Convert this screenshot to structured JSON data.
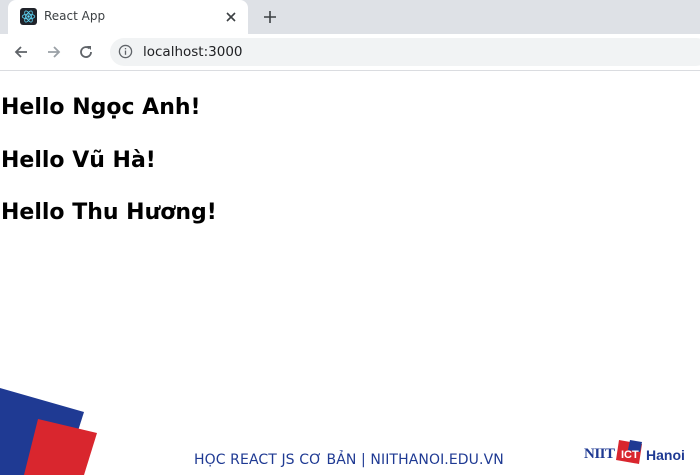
{
  "browser": {
    "tab": {
      "title": "React App"
    },
    "address_bar": {
      "url": "localhost:3000"
    }
  },
  "page": {
    "greetings": [
      "Hello Ngọc Anh!",
      "Hello Vũ Hà!",
      "Hello Thu Hương!"
    ]
  },
  "footer": {
    "caption": "HỌC REACT JS CƠ BẢN | NIITHANOI.EDU.VN",
    "logo": {
      "left_text": "NIIT",
      "box_text": "ICT",
      "right_text": "Hanoi"
    }
  },
  "colors": {
    "brand_blue": "#1f3a93",
    "brand_red": "#d9262e"
  }
}
